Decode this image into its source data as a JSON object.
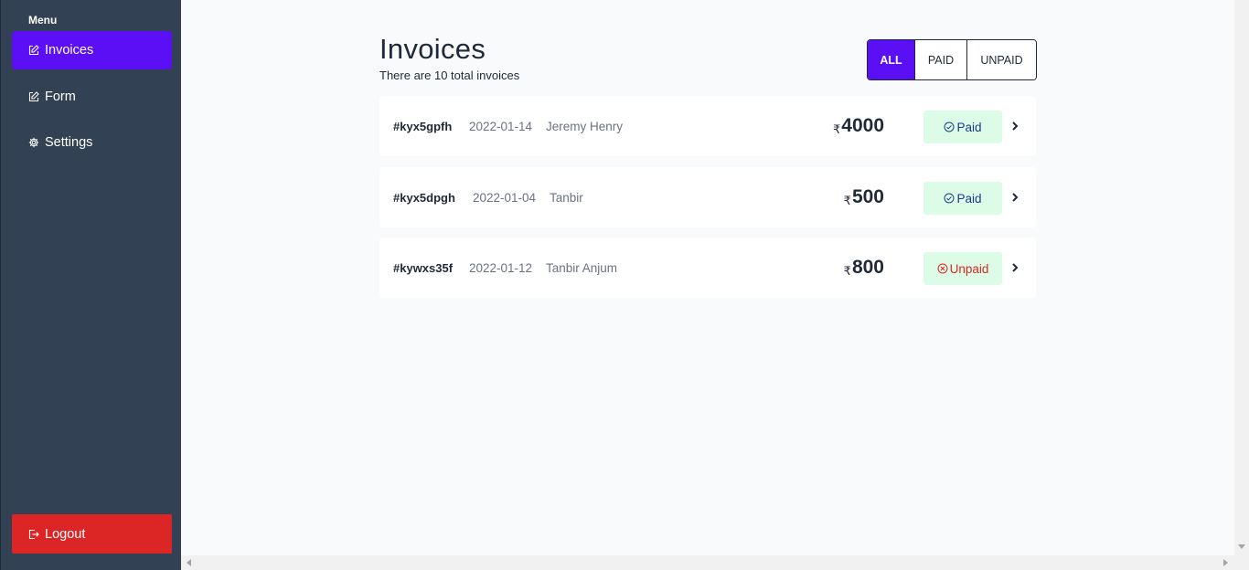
{
  "sidebar": {
    "menu_label": "Menu",
    "items": [
      {
        "label": "Invoices",
        "icon": "edit-icon",
        "active": true
      },
      {
        "label": "Form",
        "icon": "edit-icon",
        "active": false
      },
      {
        "label": "Settings",
        "icon": "gear-icon",
        "active": false
      }
    ],
    "logout_label": "Logout",
    "logout_icon": "logout-icon"
  },
  "header": {
    "title": "Invoices",
    "subtitle": "There are 10 total invoices"
  },
  "filters": [
    {
      "label": "ALL",
      "active": true
    },
    {
      "label": "PAID",
      "active": false
    },
    {
      "label": "UNPAID",
      "active": false
    }
  ],
  "invoices": [
    {
      "id": "#kyx5gpfh",
      "date": "2022-01-14",
      "name": "Jeremy Henry",
      "currency": "₹",
      "amount": "4000",
      "status": "Paid"
    },
    {
      "id": "#kyx5dpgh",
      "date": "2022-01-04",
      "name": "Tanbir",
      "currency": "₹",
      "amount": "500",
      "status": "Paid"
    },
    {
      "id": "#kywxs35f",
      "date": "2022-01-12",
      "name": "Tanbir Anjum",
      "currency": "₹",
      "amount": "800",
      "status": "Unpaid"
    }
  ],
  "colors": {
    "sidebar_bg": "#334155",
    "accent": "#5b0ff5",
    "logout_bg": "#dc2626",
    "badge_bg": "#dcfce7",
    "paid_text": "#1e3a8a",
    "unpaid_text": "#dc2626"
  }
}
